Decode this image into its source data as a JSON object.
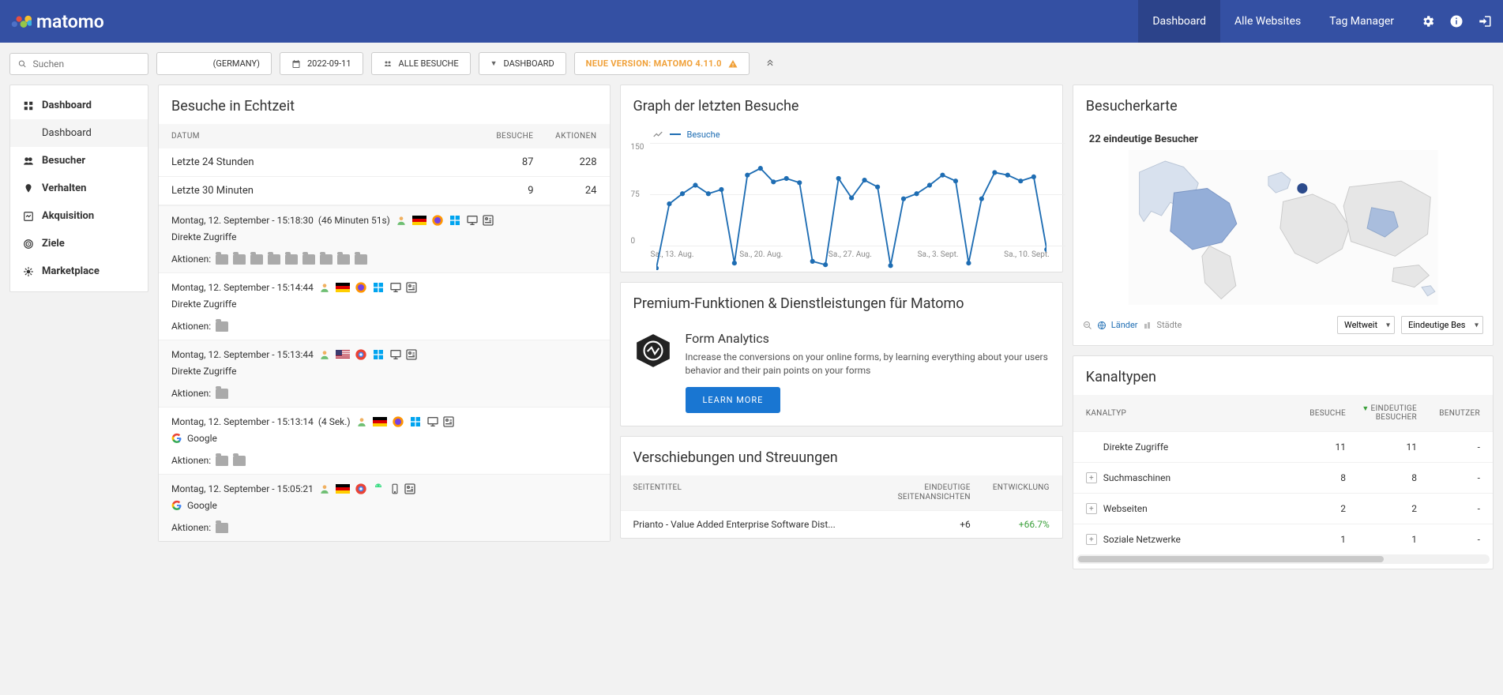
{
  "header": {
    "logo_text": "matomo",
    "nav": [
      {
        "label": "Dashboard",
        "active": true
      },
      {
        "label": "Alle Websites",
        "active": false
      },
      {
        "label": "Tag Manager",
        "active": false
      }
    ]
  },
  "toolbar": {
    "search_placeholder": "Suchen",
    "site": "(GERMANY)",
    "date": "2022-09-11",
    "segment": "ALLE BESUCHE",
    "dashboard_label": "DASHBOARD",
    "update_text": "NEUE VERSION: MATOMO 4.11.0"
  },
  "sidebar": {
    "items": [
      {
        "id": "dashboard",
        "label": "Dashboard",
        "bold": true,
        "sub": [
          {
            "label": "Dashboard"
          }
        ]
      },
      {
        "id": "besucher",
        "label": "Besucher",
        "bold": true
      },
      {
        "id": "verhalten",
        "label": "Verhalten",
        "bold": true
      },
      {
        "id": "akquisition",
        "label": "Akquisition",
        "bold": true
      },
      {
        "id": "ziele",
        "label": "Ziele",
        "bold": true
      },
      {
        "id": "marketplace",
        "label": "Marketplace",
        "bold": true
      }
    ]
  },
  "realtime": {
    "title": "Besuche in Echtzeit",
    "cols": {
      "date": "DATUM",
      "visits": "BESUCHE",
      "actions": "AKTIONEN"
    },
    "summary": [
      {
        "label": "Letzte 24 Stunden",
        "visits": "87",
        "actions": "228"
      },
      {
        "label": "Letzte 30 Minuten",
        "visits": "9",
        "actions": "24"
      }
    ],
    "actions_label": "Aktionen:",
    "visits": [
      {
        "date": "Montag, 12. September",
        "time": "15:18:30",
        "duration": "(46 Minuten 51s)",
        "flag": "de",
        "referrer": "Direkte Zugriffe",
        "browser": "firefox",
        "os": "windows",
        "action_count": 9,
        "alt": true
      },
      {
        "date": "Montag, 12. September",
        "time": "15:14:44",
        "duration": "",
        "flag": "de",
        "referrer": "Direkte Zugriffe",
        "browser": "firefox",
        "os": "windows",
        "action_count": 1,
        "alt": false
      },
      {
        "date": "Montag, 12. September",
        "time": "15:13:44",
        "duration": "",
        "flag": "us",
        "referrer": "Direkte Zugriffe",
        "browser": "chrome",
        "os": "windows",
        "action_count": 1,
        "alt": true
      },
      {
        "date": "Montag, 12. September",
        "time": "15:13:14",
        "duration": "(4 Sek.)",
        "flag": "de",
        "referrer": "Google",
        "browser": "firefox",
        "os": "windows",
        "action_count": 2,
        "alt": false,
        "searchengine": true
      },
      {
        "date": "Montag, 12. September",
        "time": "15:05:21",
        "duration": "",
        "flag": "de",
        "referrer": "Google",
        "browser": "chrome",
        "os": "android",
        "action_count": 1,
        "alt": true,
        "searchengine": true,
        "mobile": true
      }
    ]
  },
  "chart": {
    "title": "Graph der letzten Besuche",
    "legend": "Besuche"
  },
  "chart_data": {
    "type": "line",
    "xlabels": [
      "Sa., 13. Aug.",
      "Sa., 20. Aug.",
      "Sa., 27. Aug.",
      "Sa., 3. Sept.",
      "Sa., 10. Sept."
    ],
    "yticks": [
      150,
      75,
      0
    ],
    "ylim": [
      0,
      150
    ],
    "points": [
      2,
      78,
      90,
      100,
      90,
      95,
      8,
      112,
      120,
      104,
      108,
      103,
      10,
      6,
      108,
      85,
      106,
      98,
      5,
      84,
      90,
      100,
      112,
      105,
      8,
      84,
      115,
      112,
      105,
      110,
      24
    ]
  },
  "premium": {
    "title": "Premium-Funktionen & Dienstleistungen für Matomo",
    "feature_title": "Form Analytics",
    "feature_desc": "Increase the conversions on your online forms, by learning everything about your users behavior and their pain points on your forms",
    "learn_more": "LEARN MORE"
  },
  "shifts": {
    "title": "Verschiebungen und Streuungen",
    "cols": {
      "title": "SEITENTITEL",
      "unique": "EINDEUTIGE SEITENANSICHTEN",
      "dev": "ENTWICKLUNG"
    },
    "rows": [
      {
        "title": "Prianto - Value Added Enterprise Software Dist...",
        "unique": "+6",
        "dev": "+66.7%"
      }
    ]
  },
  "map": {
    "title": "Besucherkarte",
    "caption": "22 eindeutige Besucher",
    "link_countries": "Länder",
    "link_cities": "Städte",
    "scope_select": "Weltweit",
    "metric_select": "Eindeutige Bes"
  },
  "channels": {
    "title": "Kanaltypen",
    "cols": {
      "type": "KANALTYP",
      "visits": "BESUCHE",
      "unique": "EINDEUTIGE BESUCHER",
      "users": "BENUTZER"
    },
    "rows": [
      {
        "label": "Direkte Zugriffe",
        "visits": "11",
        "unique": "11",
        "users": "-",
        "expand": false
      },
      {
        "label": "Suchmaschinen",
        "visits": "8",
        "unique": "8",
        "users": "-",
        "expand": true
      },
      {
        "label": "Webseiten",
        "visits": "2",
        "unique": "2",
        "users": "-",
        "expand": true
      },
      {
        "label": "Soziale Netzwerke",
        "visits": "1",
        "unique": "1",
        "users": "-",
        "expand": true
      }
    ]
  }
}
